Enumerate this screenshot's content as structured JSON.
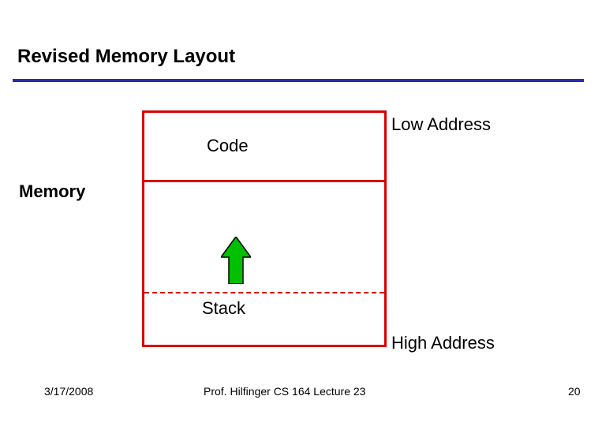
{
  "slide": {
    "title": "Revised Memory Layout",
    "labels": {
      "code": "Code",
      "stack": "Stack",
      "memory": "Memory",
      "low_address": "Low Address",
      "high_address": "High Address"
    },
    "footer": {
      "date": "3/17/2008",
      "center": "Prof. Hilfinger  CS 164  Lecture 23",
      "page": "20"
    },
    "colors": {
      "underline": "#2a2aad",
      "box_border": "#d80000",
      "arrow_fill": "#00c000"
    },
    "diagram": {
      "regions": [
        "Code",
        "Stack"
      ],
      "address_low": "Low Address",
      "address_high": "High Address",
      "stack_growth_direction": "up"
    }
  }
}
